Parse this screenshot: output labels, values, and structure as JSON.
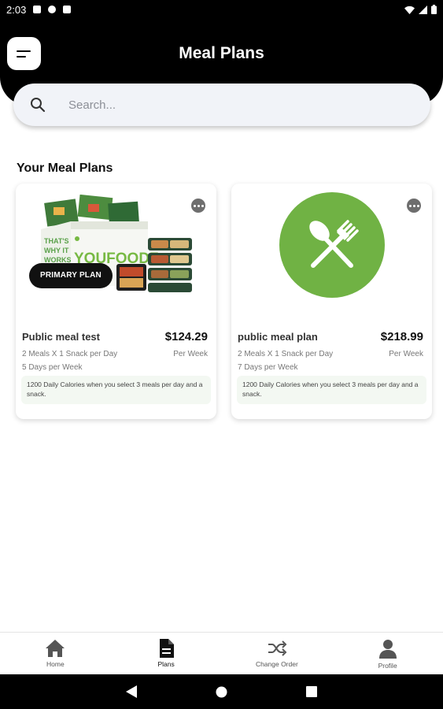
{
  "status_bar": {
    "time": "2:03"
  },
  "header": {
    "title": "Meal Plans"
  },
  "search": {
    "placeholder": "Search..."
  },
  "section": {
    "title": "Your Meal Plans"
  },
  "plans": [
    {
      "name": "Public meal test",
      "price": "$124.29",
      "meals": "2 Meals X 1 Snack per Day",
      "per": "Per Week",
      "days": "5 Days per Week",
      "note": "1200 Daily Calories when you select 3 meals per day and a snack.",
      "badge": "PRIMARY PLAN",
      "image_text": "YOUFOODZ"
    },
    {
      "name": "public meal plan",
      "price": "$218.99",
      "meals": "2 Meals X 1 Snack per Day",
      "per": "Per Week",
      "days": "7 Days per Week",
      "note": "1200 Daily Calories when you select 3 meals per day and a snack."
    }
  ],
  "bottom_nav": {
    "items": [
      {
        "label": "Home",
        "icon": "home-icon"
      },
      {
        "label": "Plans",
        "icon": "document-icon",
        "active": true
      },
      {
        "label": "Change Order",
        "icon": "shuffle-icon"
      },
      {
        "label": "Profile",
        "icon": "person-icon"
      }
    ]
  },
  "colors": {
    "header_bg": "#000000",
    "accent_green": "#70b244",
    "search_bg": "#f1f3f8",
    "note_bg": "#f3f8f2"
  }
}
